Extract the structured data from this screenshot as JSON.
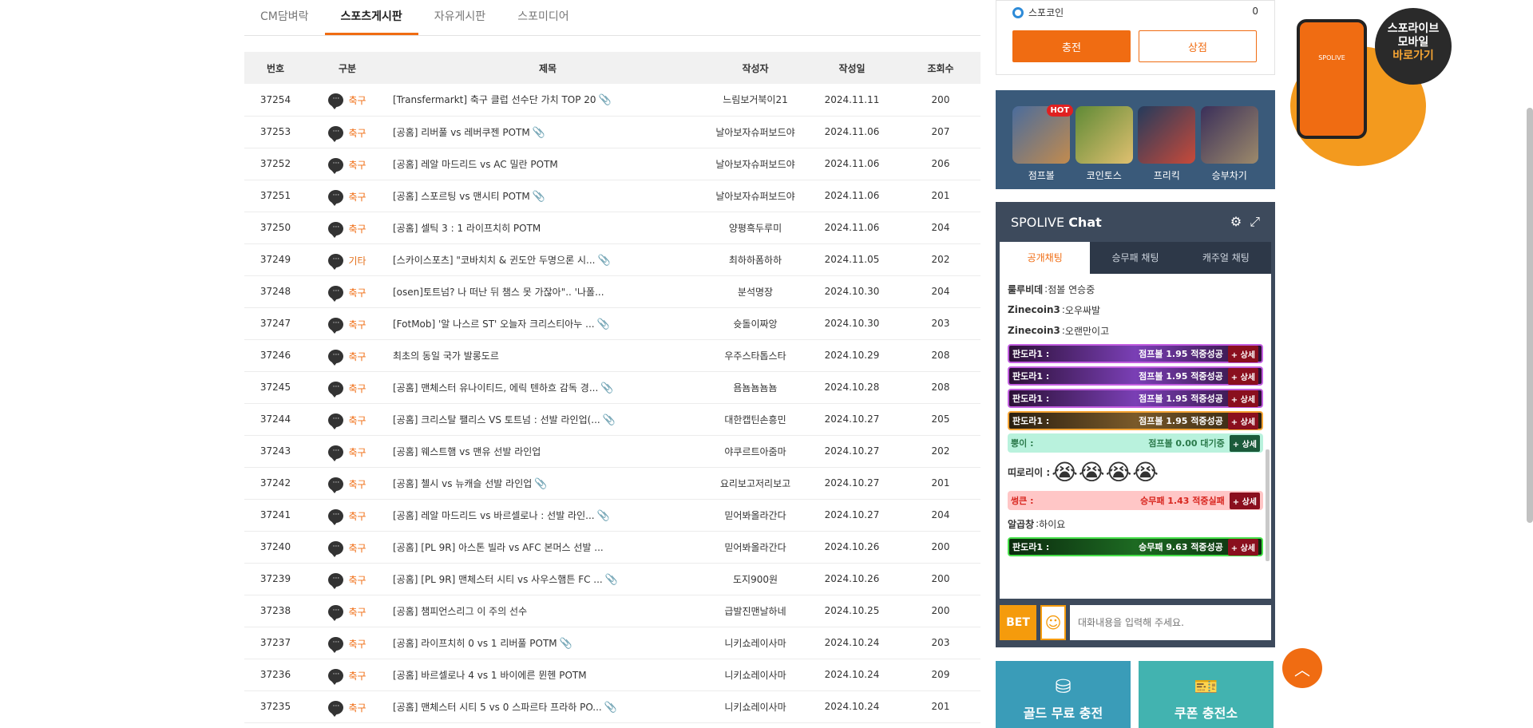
{
  "tabs": [
    {
      "label": "CM담벼락"
    },
    {
      "label": "스포츠게시판"
    },
    {
      "label": "자유게시판"
    },
    {
      "label": "스포미디어"
    }
  ],
  "table": {
    "headers": [
      "번호",
      "구분",
      "제목",
      "작성자",
      "작성일",
      "조회수"
    ],
    "rows": [
      {
        "no": "37254",
        "cat": "축구",
        "title": "[Transfermarkt] 축구 클럽 선수단 가치 TOP 20",
        "clip": true,
        "author": "느림보거북이21",
        "date": "2024.11.11",
        "views": "200"
      },
      {
        "no": "37253",
        "cat": "축구",
        "title": "[공홈] 리버풀 vs 레버쿠젠 POTM",
        "clip": true,
        "author": "날아보자슈퍼보드야",
        "date": "2024.11.06",
        "views": "207"
      },
      {
        "no": "37252",
        "cat": "축구",
        "title": "[공홈] 레알 마드리드 vs AC 밀란 POTM",
        "clip": false,
        "author": "날아보자슈퍼보드야",
        "date": "2024.11.06",
        "views": "206"
      },
      {
        "no": "37251",
        "cat": "축구",
        "title": "[공홈] 스포르팅 vs 맨시티 POTM",
        "clip": true,
        "author": "날아보자슈퍼보드야",
        "date": "2024.11.06",
        "views": "201"
      },
      {
        "no": "37250",
        "cat": "축구",
        "title": "[공홈] 셀틱 3 : 1 라이프치히 POTM",
        "clip": false,
        "author": "양평흑두루미",
        "date": "2024.11.06",
        "views": "204"
      },
      {
        "no": "37249",
        "cat": "기타",
        "title": "[스카이스포츠] \"코바치치 & 귄도안 두명으론 시...",
        "clip": true,
        "author": "최하하폼하하",
        "date": "2024.11.05",
        "views": "202"
      },
      {
        "no": "37248",
        "cat": "축구",
        "title": "[osen]토트넘? 나 떠난 뒤 챔스 못 가잖아\".. '나폴...",
        "clip": false,
        "author": "분석명장",
        "date": "2024.10.30",
        "views": "204"
      },
      {
        "no": "37247",
        "cat": "축구",
        "title": "[FotMob] '알 나스르 ST' 오늘자 크리스티아누 ...",
        "clip": true,
        "author": "슛돌이짜앙",
        "date": "2024.10.30",
        "views": "203"
      },
      {
        "no": "37246",
        "cat": "축구",
        "title": "최초의 동일 국가 발롱도르",
        "clip": false,
        "author": "우주스타톱스타",
        "date": "2024.10.29",
        "views": "208"
      },
      {
        "no": "37245",
        "cat": "축구",
        "title": "[공홈] 맨체스터 유나이티드, 에릭 텐하흐 감독 경...",
        "clip": true,
        "author": "욤뇸뇸뇸뇸",
        "date": "2024.10.28",
        "views": "208"
      },
      {
        "no": "37244",
        "cat": "축구",
        "title": "[공홈] 크리스탈 팰리스 VS 토트넘 : 선발 라인업(...",
        "clip": true,
        "author": "대한캡틴손흥민",
        "date": "2024.10.27",
        "views": "205"
      },
      {
        "no": "37243",
        "cat": "축구",
        "title": "[공홈] 웨스트햄 vs 맨유 선발 라인업",
        "clip": false,
        "author": "야쿠르트아줌마",
        "date": "2024.10.27",
        "views": "202"
      },
      {
        "no": "37242",
        "cat": "축구",
        "title": "[공홈] 첼시 vs 뉴캐슬 선발 라인업",
        "clip": true,
        "author": "요리보고저리보고",
        "date": "2024.10.27",
        "views": "201"
      },
      {
        "no": "37241",
        "cat": "축구",
        "title": "[공홈] 레알 마드리드 vs 바르셀로나 : 선발 라인...",
        "clip": true,
        "author": "믿어봐올라간다",
        "date": "2024.10.27",
        "views": "204"
      },
      {
        "no": "37240",
        "cat": "축구",
        "title": "[공홈] [PL 9R] 아스톤 빌라 vs AFC 본머스 선발 ...",
        "clip": false,
        "author": "믿어봐올라간다",
        "date": "2024.10.26",
        "views": "200"
      },
      {
        "no": "37239",
        "cat": "축구",
        "title": "[공홈] [PL 9R] 맨체스터 시티 vs 사우스햄튼 FC ...",
        "clip": true,
        "author": "도지900원",
        "date": "2024.10.26",
        "views": "200"
      },
      {
        "no": "37238",
        "cat": "축구",
        "title": "[공홈] 챔피언스리그 이 주의 선수",
        "clip": false,
        "author": "급발진맨날하네",
        "date": "2024.10.25",
        "views": "200"
      },
      {
        "no": "37237",
        "cat": "축구",
        "title": "[공홈] 라이프치히 0 vs 1 리버풀 POTM",
        "clip": true,
        "author": "니키쇼레이사마",
        "date": "2024.10.24",
        "views": "203"
      },
      {
        "no": "37236",
        "cat": "축구",
        "title": "[공홈] 바르셀로나 4 vs 1 바이에른 뮌헨 POTM",
        "clip": false,
        "author": "니키쇼레이사마",
        "date": "2024.10.24",
        "views": "209"
      },
      {
        "no": "37235",
        "cat": "축구",
        "title": "[공홈] 맨체스터 시티 5 vs 0 스파르타 프라하 PO...",
        "clip": true,
        "author": "니키쇼레이사마",
        "date": "2024.10.24",
        "views": "201"
      }
    ]
  },
  "coin": {
    "label": "스포코인",
    "value": "0",
    "charge": "충전",
    "shop": "상점"
  },
  "games": [
    {
      "label": "점프볼",
      "hot": "HOT"
    },
    {
      "label": "코인토스"
    },
    {
      "label": "프리킥"
    },
    {
      "label": "승부차기"
    }
  ],
  "chat": {
    "title_prefix": "SPOLIVE",
    "title_bold": "Chat",
    "tabs": [
      "공개채팅",
      "승무패 채팅",
      "캐주얼 채팅"
    ],
    "messages": [
      {
        "type": "text",
        "user": "룰루비데",
        "text": "점볼 연승중"
      },
      {
        "type": "text",
        "user": "Zinecoin3",
        "text": "오우싸발"
      },
      {
        "type": "text",
        "user": "Zinecoin3",
        "text": "오랜만이고"
      },
      {
        "type": "bar",
        "style": "purple",
        "user": "판도라1 :",
        "info": "점프볼 1.95 적중성공",
        "more": "+ 상세"
      },
      {
        "type": "bar",
        "style": "purple",
        "user": "판도라1 :",
        "info": "점프볼 1.95 적중성공",
        "more": "+ 상세"
      },
      {
        "type": "bar",
        "style": "purple",
        "user": "판도라1 :",
        "info": "점프볼 1.95 적중성공",
        "more": "+ 상세"
      },
      {
        "type": "bar",
        "style": "gold",
        "user": "판도라1 :",
        "info": "점프볼 1.95 적중성공",
        "more": "+ 상세"
      },
      {
        "type": "bar",
        "style": "mint",
        "user": "뿡이 :",
        "info": "점프볼 0.00 대기중",
        "more": "+ 상세"
      },
      {
        "type": "emoji",
        "user": "띠로리이 :",
        "text": "😭😭😭😭"
      },
      {
        "type": "bar",
        "style": "pink",
        "user": "썽큰 :",
        "info": "승무패 1.43 적중실패",
        "more": "+ 상세"
      },
      {
        "type": "text",
        "user": "알곱창",
        "text": "하이요"
      },
      {
        "type": "bar",
        "style": "green",
        "user": "판도라1 :",
        "info": "승무패 9.63 적중성공",
        "more": "+ 상세"
      }
    ],
    "bet": "BET",
    "placeholder": "대화내용을 입력해 주세요."
  },
  "bottom": [
    {
      "label": "골드 무료 충전"
    },
    {
      "label": "쿠폰 충전소"
    }
  ],
  "promo": {
    "line1": "스포라이브",
    "line2": "모바일",
    "line3": "바로가기",
    "brand": "SPOLIVE"
  }
}
